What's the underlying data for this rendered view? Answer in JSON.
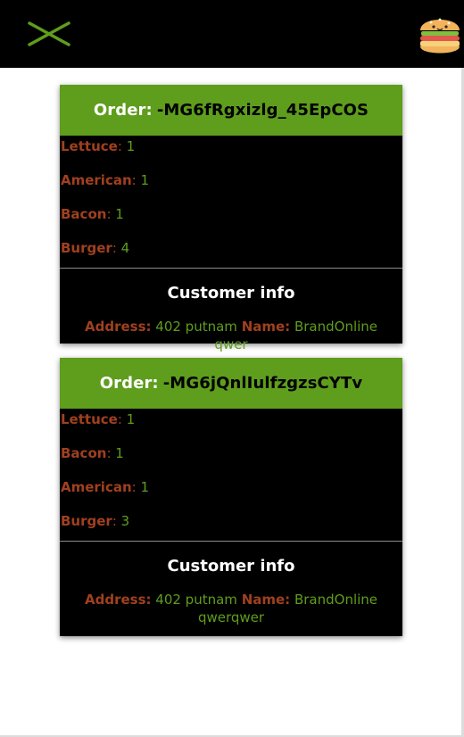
{
  "colors": {
    "accent_green": "#5f9d1d",
    "label_brown": "#a0401f",
    "card_bg": "#000000"
  },
  "header": {
    "menu_icon": "close-x-icon",
    "logo_icon": "burger-logo-icon"
  },
  "orders": [
    {
      "order_label": "Order:",
      "order_id": "-MG6fRgxizlg_45EpCOS",
      "ingredients": [
        {
          "name": "Lettuce",
          "qty": "1"
        },
        {
          "name": "American",
          "qty": "1"
        },
        {
          "name": "Bacon",
          "qty": "1"
        },
        {
          "name": "Burger",
          "qty": "4"
        }
      ],
      "customer_title": "Customer info",
      "address_label": "Address:",
      "address": "402 putnam",
      "name_label": "Name:",
      "name": "BrandOnline qwer"
    },
    {
      "order_label": "Order:",
      "order_id": "-MG6jQnlIulfzgzsCYTv",
      "ingredients": [
        {
          "name": "Lettuce",
          "qty": "1"
        },
        {
          "name": "Bacon",
          "qty": "1"
        },
        {
          "name": "American",
          "qty": "1"
        },
        {
          "name": "Burger",
          "qty": "3"
        }
      ],
      "customer_title": "Customer info",
      "address_label": "Address:",
      "address": "402 putnam",
      "name_label": "Name:",
      "name": "BrandOnline qwerqwer"
    }
  ]
}
